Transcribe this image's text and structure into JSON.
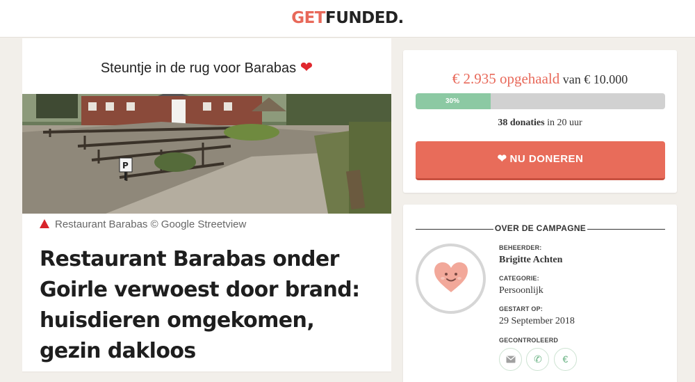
{
  "brand": {
    "get": "GET",
    "funded": "FUNDED."
  },
  "campaign": {
    "title": "Steuntje in de rug voor Barabas",
    "title_heart": "❤",
    "photo_caption": "Restaurant Barabas © Google Streetview",
    "headline": "Restaurant Barabas onder Goirle verwoest door brand: huisdieren omgekomen, gezin dakloos"
  },
  "donation": {
    "raised": "€ 2.935 opgehaald",
    "goal_text": "van € 10.000",
    "progress_label": "30%",
    "progress_fraction": 0.3,
    "donations_count": "38 donaties",
    "donations_period": "in 20 uur",
    "button_label": "NU DONEREN",
    "button_icon": "heart-icon"
  },
  "about": {
    "heading": "OVER DE CAMPAGNE",
    "manager_label": "BEHEERDER:",
    "manager_value": "Brigitte Achten",
    "category_label": "CATEGORIE:",
    "category_value": "Persoonlijk",
    "started_label": "GESTART OP:",
    "started_value": "29 September 2018",
    "verified_label": "GECONTROLEERD",
    "verified_icons": [
      "email-icon",
      "phone-icon",
      "euro-icon"
    ]
  },
  "colors": {
    "brand_coral": "#e8695a",
    "progress_green": "#8cc9a3",
    "button_coral": "#e86c5a",
    "heart_red": "#e0282e"
  }
}
